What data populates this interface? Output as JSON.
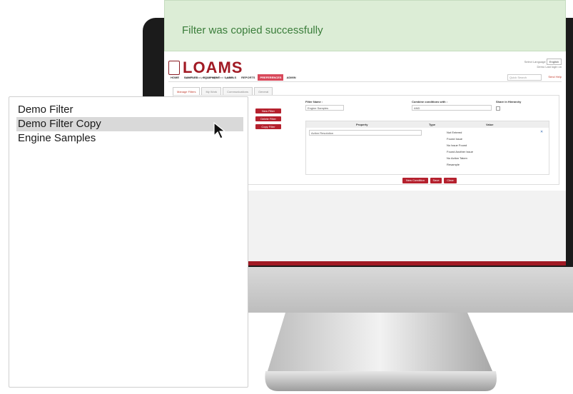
{
  "toast": {
    "message": "Filter was copied successfully",
    "bg_color": "#dcedd6",
    "text_color": "#3a7d3a"
  },
  "app": {
    "logo_text": "LOAMS",
    "logo_subtitle": "Lube Oil Analysis Management System",
    "top_right": {
      "language_label": "Select Language",
      "language_value": "English",
      "user": "Demo",
      "last_login": "Last login on"
    },
    "nav": [
      "HOME",
      "SAMPLES",
      "EQUIPMENT",
      "LABELS",
      "REPORTS",
      "PREFERENCES",
      "ADMIN"
    ],
    "nav_active": "PREFERENCES",
    "quick_search_placeholder": "Quick Search",
    "send_help": "Send Help",
    "tabs": [
      "Manage Filters",
      "My Work",
      "Communications",
      "General"
    ],
    "active_tab": "Manage Filters",
    "buttons": {
      "new_filter": "New Filter",
      "delete_filter": "Delete Filter",
      "copy_filter": "Copy Filter"
    },
    "filter_name_label": "Filter Name :",
    "filter_name_value": "Engine Samples",
    "combine_label": "Combine conditions with :",
    "combine_value": "AND",
    "share_label": "Share in Hierarchy",
    "grid_headers": [
      "Property",
      "Type",
      "Value"
    ],
    "property_value": "Action Resolution",
    "value_options": [
      "Not Entered",
      "Found Issue",
      "No Issue Found",
      "Found Another Issue",
      "No Action Taken",
      "Resample"
    ],
    "bottom_buttons": {
      "new_condition": "New Condition",
      "save": "Save",
      "clear": "Clear"
    }
  },
  "dropdown": {
    "items": [
      "Demo Filter",
      "Demo Filter Copy",
      "Engine Samples"
    ],
    "highlighted_index": 1
  },
  "colors": {
    "brand_red": "#a11a24",
    "button_red": "#b5212e"
  }
}
